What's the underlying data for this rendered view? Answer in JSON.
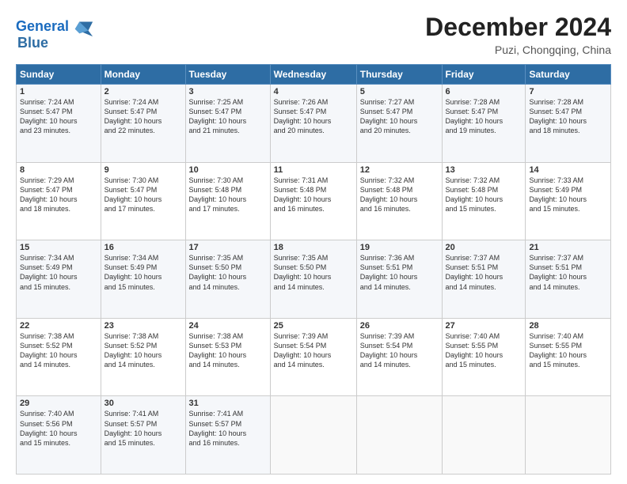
{
  "logo": {
    "line1": "General",
    "line2": "Blue"
  },
  "title": "December 2024",
  "subtitle": "Puzi, Chongqing, China",
  "weekdays": [
    "Sunday",
    "Monday",
    "Tuesday",
    "Wednesday",
    "Thursday",
    "Friday",
    "Saturday"
  ],
  "weeks": [
    [
      {
        "day": "1",
        "info": "Sunrise: 7:24 AM\nSunset: 5:47 PM\nDaylight: 10 hours\nand 23 minutes."
      },
      {
        "day": "2",
        "info": "Sunrise: 7:24 AM\nSunset: 5:47 PM\nDaylight: 10 hours\nand 22 minutes."
      },
      {
        "day": "3",
        "info": "Sunrise: 7:25 AM\nSunset: 5:47 PM\nDaylight: 10 hours\nand 21 minutes."
      },
      {
        "day": "4",
        "info": "Sunrise: 7:26 AM\nSunset: 5:47 PM\nDaylight: 10 hours\nand 20 minutes."
      },
      {
        "day": "5",
        "info": "Sunrise: 7:27 AM\nSunset: 5:47 PM\nDaylight: 10 hours\nand 20 minutes."
      },
      {
        "day": "6",
        "info": "Sunrise: 7:28 AM\nSunset: 5:47 PM\nDaylight: 10 hours\nand 19 minutes."
      },
      {
        "day": "7",
        "info": "Sunrise: 7:28 AM\nSunset: 5:47 PM\nDaylight: 10 hours\nand 18 minutes."
      }
    ],
    [
      {
        "day": "8",
        "info": "Sunrise: 7:29 AM\nSunset: 5:47 PM\nDaylight: 10 hours\nand 18 minutes."
      },
      {
        "day": "9",
        "info": "Sunrise: 7:30 AM\nSunset: 5:47 PM\nDaylight: 10 hours\nand 17 minutes."
      },
      {
        "day": "10",
        "info": "Sunrise: 7:30 AM\nSunset: 5:48 PM\nDaylight: 10 hours\nand 17 minutes."
      },
      {
        "day": "11",
        "info": "Sunrise: 7:31 AM\nSunset: 5:48 PM\nDaylight: 10 hours\nand 16 minutes."
      },
      {
        "day": "12",
        "info": "Sunrise: 7:32 AM\nSunset: 5:48 PM\nDaylight: 10 hours\nand 16 minutes."
      },
      {
        "day": "13",
        "info": "Sunrise: 7:32 AM\nSunset: 5:48 PM\nDaylight: 10 hours\nand 15 minutes."
      },
      {
        "day": "14",
        "info": "Sunrise: 7:33 AM\nSunset: 5:49 PM\nDaylight: 10 hours\nand 15 minutes."
      }
    ],
    [
      {
        "day": "15",
        "info": "Sunrise: 7:34 AM\nSunset: 5:49 PM\nDaylight: 10 hours\nand 15 minutes."
      },
      {
        "day": "16",
        "info": "Sunrise: 7:34 AM\nSunset: 5:49 PM\nDaylight: 10 hours\nand 15 minutes."
      },
      {
        "day": "17",
        "info": "Sunrise: 7:35 AM\nSunset: 5:50 PM\nDaylight: 10 hours\nand 14 minutes."
      },
      {
        "day": "18",
        "info": "Sunrise: 7:35 AM\nSunset: 5:50 PM\nDaylight: 10 hours\nand 14 minutes."
      },
      {
        "day": "19",
        "info": "Sunrise: 7:36 AM\nSunset: 5:51 PM\nDaylight: 10 hours\nand 14 minutes."
      },
      {
        "day": "20",
        "info": "Sunrise: 7:37 AM\nSunset: 5:51 PM\nDaylight: 10 hours\nand 14 minutes."
      },
      {
        "day": "21",
        "info": "Sunrise: 7:37 AM\nSunset: 5:51 PM\nDaylight: 10 hours\nand 14 minutes."
      }
    ],
    [
      {
        "day": "22",
        "info": "Sunrise: 7:38 AM\nSunset: 5:52 PM\nDaylight: 10 hours\nand 14 minutes."
      },
      {
        "day": "23",
        "info": "Sunrise: 7:38 AM\nSunset: 5:52 PM\nDaylight: 10 hours\nand 14 minutes."
      },
      {
        "day": "24",
        "info": "Sunrise: 7:38 AM\nSunset: 5:53 PM\nDaylight: 10 hours\nand 14 minutes."
      },
      {
        "day": "25",
        "info": "Sunrise: 7:39 AM\nSunset: 5:54 PM\nDaylight: 10 hours\nand 14 minutes."
      },
      {
        "day": "26",
        "info": "Sunrise: 7:39 AM\nSunset: 5:54 PM\nDaylight: 10 hours\nand 14 minutes."
      },
      {
        "day": "27",
        "info": "Sunrise: 7:40 AM\nSunset: 5:55 PM\nDaylight: 10 hours\nand 15 minutes."
      },
      {
        "day": "28",
        "info": "Sunrise: 7:40 AM\nSunset: 5:55 PM\nDaylight: 10 hours\nand 15 minutes."
      }
    ],
    [
      {
        "day": "29",
        "info": "Sunrise: 7:40 AM\nSunset: 5:56 PM\nDaylight: 10 hours\nand 15 minutes."
      },
      {
        "day": "30",
        "info": "Sunrise: 7:41 AM\nSunset: 5:57 PM\nDaylight: 10 hours\nand 15 minutes."
      },
      {
        "day": "31",
        "info": "Sunrise: 7:41 AM\nSunset: 5:57 PM\nDaylight: 10 hours\nand 16 minutes."
      },
      {
        "day": "",
        "info": ""
      },
      {
        "day": "",
        "info": ""
      },
      {
        "day": "",
        "info": ""
      },
      {
        "day": "",
        "info": ""
      }
    ]
  ]
}
